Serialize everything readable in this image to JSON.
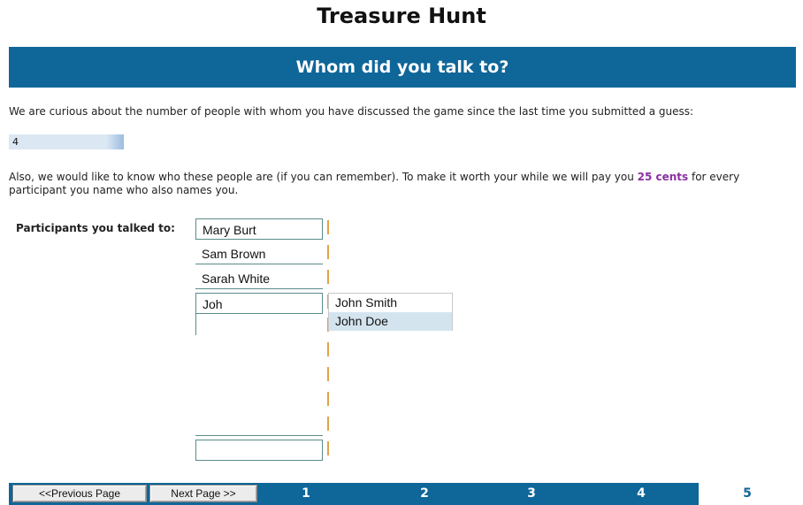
{
  "title": "Treasure Hunt",
  "section_title": "Whom did you talk to?",
  "intro_text": "We are curious about the number of people with whom you have discussed the game since the last time you submitted a guess:",
  "people_count": "4",
  "reward_text_before": "Also, we would like to know who these people are (if you can remember). To make it worth your while we will pay you ",
  "reward_amount": "25 cents",
  "reward_text_after": " for every participant you name who also names you.",
  "participants_label": "Participants you talked to:",
  "participants": [
    "Mary Burt",
    "Sam Brown",
    "Sarah White",
    "Joh",
    "",
    "",
    "",
    "",
    "",
    ""
  ],
  "autocomplete": {
    "options": [
      "John Smith",
      "John Doe"
    ],
    "highlighted": "John Doe"
  },
  "nav": {
    "prev_label": "<<Previous Page",
    "next_label": "Next Page >>",
    "pages": [
      "1",
      "2",
      "3",
      "4",
      "5"
    ],
    "current_page": "5"
  },
  "colors": {
    "banner": "#0f6699",
    "reward_highlight": "#8b2fa0",
    "input_border": "#5a8c8a",
    "caret_marker": "#e2a24a"
  }
}
